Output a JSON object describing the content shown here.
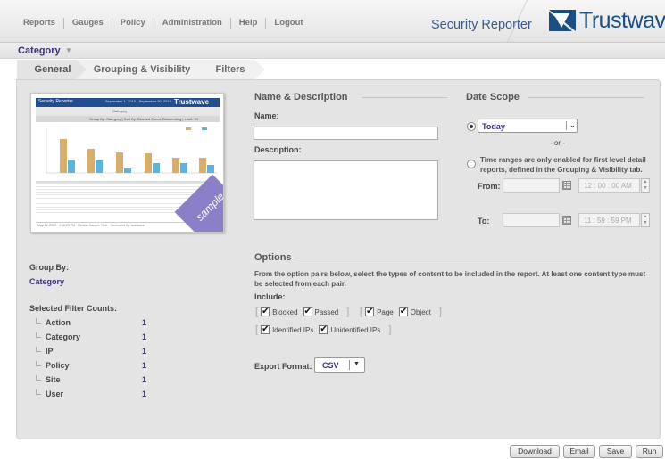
{
  "nav": {
    "items": [
      "Reports",
      "Gauges",
      "Policy",
      "Administration",
      "Help",
      "Logout"
    ],
    "app_title": "Security Reporter",
    "logo_text": "Trustwave",
    "logo_tm": "®"
  },
  "category_bar": {
    "label": "Category"
  },
  "tabs": [
    {
      "label": "General",
      "active": true
    },
    {
      "label": "Grouping & Visibility",
      "active": false
    },
    {
      "label": "Filters",
      "active": false
    }
  ],
  "preview": {
    "header_title": "Security Reporter",
    "header_dates": "September 1, 2013 - September 30, 2013",
    "logo": "Trustwave",
    "subtitle": "Category",
    "group_line": "Group By: Category | Sort By: Blocked Count, Descending | Limit: 10",
    "footer": "May 11, 2013 · 3:16:23 PM · Flexible Sample Time · Generated by: trustwave",
    "badge": "sample"
  },
  "summary": {
    "group_by_label": "Group By:",
    "group_by_value": "Category",
    "filter_counts_label": "Selected Filter Counts:",
    "filters": [
      {
        "name": "Action",
        "count": "1"
      },
      {
        "name": "Category",
        "count": "1"
      },
      {
        "name": "IP",
        "count": "1"
      },
      {
        "name": "Policy",
        "count": "1"
      },
      {
        "name": "Site",
        "count": "1"
      },
      {
        "name": "User",
        "count": "1"
      }
    ]
  },
  "name_desc": {
    "title": "Name & Description",
    "name_label": "Name:",
    "name_value": "",
    "description_label": "Description:",
    "description_value": ""
  },
  "date_scope": {
    "title": "Date Scope",
    "preset_value": "Today",
    "or_text": "- or -",
    "range_note": "Time ranges are only enabled for first level detail reports, defined in the Grouping & Visibility tab.",
    "from_label": "From:",
    "from_time": "12 : 00 : 00 AM",
    "to_label": "To:",
    "to_time": "11 : 59 : 59 PM"
  },
  "options": {
    "title": "Options",
    "description": "From the option pairs below, select the types of content to be included in the report. At least one content type must be selected from each pair.",
    "include_label": "Include:",
    "pairs": [
      [
        {
          "label": "Blocked",
          "checked": true
        },
        {
          "label": "Passed",
          "checked": true
        }
      ],
      [
        {
          "label": "Page",
          "checked": true
        },
        {
          "label": "Object",
          "checked": true
        }
      ],
      [
        {
          "label": "Identified IPs",
          "checked": true
        },
        {
          "label": "Unidentified IPs",
          "checked": true
        }
      ]
    ],
    "export_label": "Export Format:",
    "export_value": "CSV"
  },
  "buttons": {
    "download": "Download",
    "email": "Email",
    "save": "Save",
    "run": "Run"
  },
  "colors": {
    "brand": "#1a4f86",
    "accent": "#3e2f7a",
    "sample_badge": "#8b7fc8",
    "bar_blocked": "#d9ae6a",
    "bar_passed": "#5ab4e4"
  }
}
